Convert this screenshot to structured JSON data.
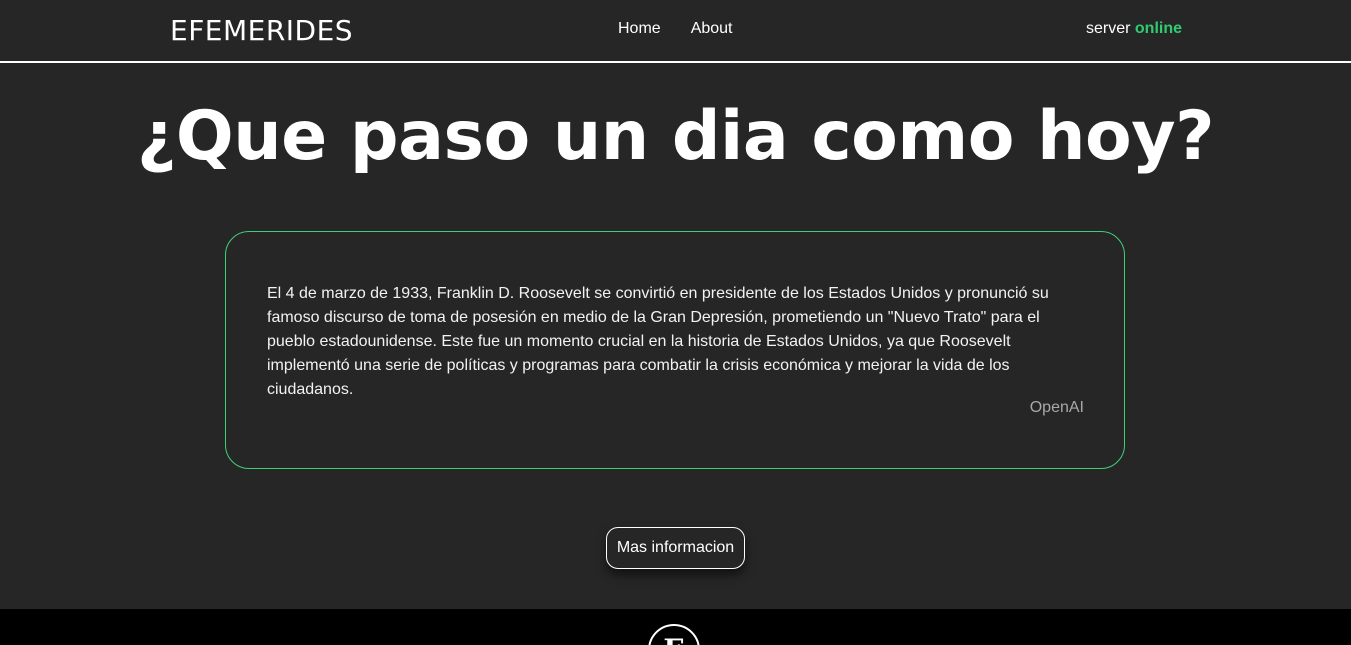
{
  "navbar": {
    "brand": "EFEMERIDES",
    "links": [
      {
        "label": "Home"
      },
      {
        "label": "About"
      }
    ],
    "server_label": "server",
    "server_status": "online",
    "status_color": "#2ecc71"
  },
  "main": {
    "headline": "¿Que paso un dia como hoy?",
    "event_text": "El 4 de marzo de 1933, Franklin D. Roosevelt se convirtió en presidente de los Estados Unidos y pronunció su famoso discurso de toma de posesión en medio de la Gran Depresión, prometiendo un \"Nuevo Trato\" para el pueblo estadounidense. Este fue un momento crucial en la historia de Estados Unidos, ya que Roosevelt implementó una serie de políticas y programas para combatir la crisis económica y mejorar la vida de los ciudadanos.",
    "source": "OpenAI",
    "more_button": "Mas informacion",
    "card_border_color": "#3fcf7a"
  },
  "footer": {
    "logo_letter": "E"
  }
}
